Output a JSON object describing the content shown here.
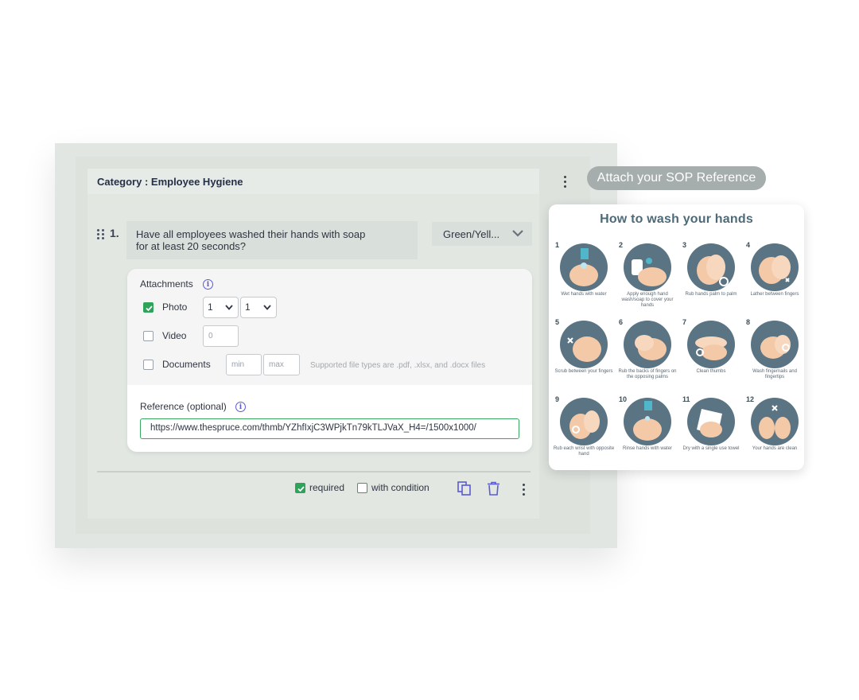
{
  "category": {
    "label": "Category : Employee Hygiene"
  },
  "sop_button": {
    "label": "Attach your SOP Reference"
  },
  "question": {
    "number": "1.",
    "text_line1": "Have all employees washed their hands with soap",
    "text_line2": "for at least 20 seconds?",
    "response_type": "Green/Yell..."
  },
  "attachments": {
    "title": "Attachments",
    "photo": {
      "label": "Photo",
      "checked": true,
      "min": "1",
      "max": "1"
    },
    "video": {
      "label": "Video",
      "checked": false,
      "placeholder": "0"
    },
    "documents": {
      "label": "Documents",
      "checked": false,
      "min_placeholder": "min",
      "max_placeholder": "max",
      "hint": "Supported file types are .pdf, .xlsx, and .docx files"
    }
  },
  "reference": {
    "label": "Reference (optional)",
    "value": "https://www.thespruce.com/thmb/YZhfIxjC3WPjkTn79kTLJVaX_H4=/1500x1000/"
  },
  "footer": {
    "required_label": "required",
    "required_checked": true,
    "condition_label": "with condition",
    "condition_checked": false
  },
  "sop_reference": {
    "title": "How to wash your hands",
    "steps": [
      {
        "n": "1",
        "caption": "Wet hands with water"
      },
      {
        "n": "2",
        "caption": "Apply enough hand wash/soap to cover your hands"
      },
      {
        "n": "3",
        "caption": "Rub hands palm to palm"
      },
      {
        "n": "4",
        "caption": "Lather between fingers"
      },
      {
        "n": "5",
        "caption": "Scrub between your fingers"
      },
      {
        "n": "6",
        "caption": "Rub the backs of fingers on the opposing palms"
      },
      {
        "n": "7",
        "caption": "Clean thumbs"
      },
      {
        "n": "8",
        "caption": "Wash fingernails and fingertips"
      },
      {
        "n": "9",
        "caption": "Rub each wrist with opposite hand"
      },
      {
        "n": "10",
        "caption": "Rinse hands with water"
      },
      {
        "n": "11",
        "caption": "Dry with a single use towel"
      },
      {
        "n": "12",
        "caption": "Your hands are clean"
      }
    ]
  },
  "colors": {
    "accent_green": "#2ea35a",
    "icon_blue": "#5b5bd6",
    "sop_circle": "#5b7483"
  }
}
